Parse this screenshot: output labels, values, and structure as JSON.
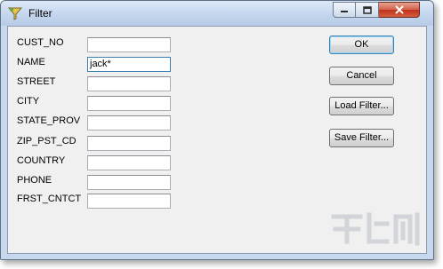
{
  "window": {
    "title": "Filter",
    "minimize_glyph": "—",
    "maximize_glyph": "□",
    "close_glyph": "✕",
    "app_icon": "filter-funnel-icon"
  },
  "fields": [
    {
      "label": "CUST_NO",
      "value": ""
    },
    {
      "label": "NAME",
      "value": "jack*"
    },
    {
      "label": "STREET",
      "value": ""
    },
    {
      "label": "CITY",
      "value": ""
    },
    {
      "label": "STATE_PROV",
      "value": ""
    },
    {
      "label": "ZIP_PST_CD",
      "value": ""
    },
    {
      "label": "COUNTRY",
      "value": ""
    },
    {
      "label": "PHONE",
      "value": ""
    },
    {
      "label": "FRST_CNTCT",
      "value": ""
    }
  ],
  "buttons": {
    "ok": "OK",
    "cancel": "Cancel",
    "load_filter": "Load Filter...",
    "save_filter": "Save Filter..."
  },
  "colors": {
    "title_bar": "#c4d6ee",
    "close_button": "#c0311b",
    "dialog_body": "#f0f0f0"
  }
}
